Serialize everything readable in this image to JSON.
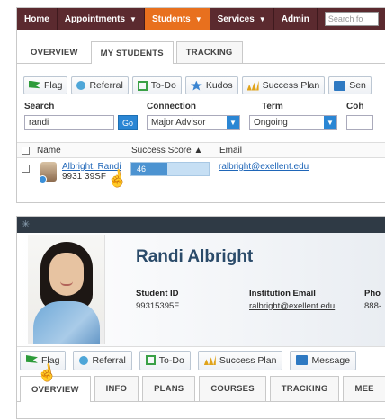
{
  "top": {
    "nav": {
      "items": [
        {
          "label": "Home",
          "caret": false
        },
        {
          "label": "Appointments",
          "caret": true
        },
        {
          "label": "Students",
          "caret": true,
          "active": true
        },
        {
          "label": "Services",
          "caret": true
        },
        {
          "label": "Admin",
          "caret": false
        }
      ],
      "search_placeholder": "Search fo",
      "caret_glyph": "▼"
    },
    "tabs": [
      {
        "label": "OVERVIEW"
      },
      {
        "label": "MY STUDENTS",
        "active": true
      },
      {
        "label": "TRACKING"
      }
    ],
    "actions": [
      {
        "label": "Flag",
        "icon": "flag-icon"
      },
      {
        "label": "Referral",
        "icon": "referral-icon"
      },
      {
        "label": "To-Do",
        "icon": "todo-icon"
      },
      {
        "label": "Kudos",
        "icon": "kudos-icon"
      },
      {
        "label": "Success Plan",
        "icon": "success-plan-icon"
      },
      {
        "label": "Sen",
        "icon": "message-icon"
      }
    ],
    "filters": {
      "search_label": "Search",
      "search_value": "randi",
      "go_label": "Go",
      "connection_label": "Connection",
      "connection_value": "Major Advisor",
      "term_label": "Term",
      "term_value": "Ongoing",
      "cohort_label": "Coh"
    },
    "table": {
      "headers": {
        "name": "Name",
        "score": "Success Score ▲",
        "email": "Email"
      },
      "row": {
        "name": "Albright, Randi",
        "id": "9931  39SF",
        "score": "46",
        "score_fraction": 0.46,
        "email": "ralbright@exellent.edu"
      }
    }
  },
  "bottom": {
    "name": "Randi Albright",
    "student_id_label": "Student ID",
    "student_id_value": "993153​95F",
    "inst_email_label": "Institution Email",
    "inst_email_value": "ralbright@exellent.edu",
    "phone_label": "Pho",
    "phone_value": "888-",
    "actions": [
      {
        "label": "Flag",
        "icon": "flag-icon"
      },
      {
        "label": "Referral",
        "icon": "referral-icon"
      },
      {
        "label": "To-Do",
        "icon": "todo-icon"
      },
      {
        "label": "Success Plan",
        "icon": "success-plan-icon"
      },
      {
        "label": "Message",
        "icon": "message-icon"
      }
    ],
    "tabs": [
      {
        "label": "OVERVIEW",
        "active": true
      },
      {
        "label": "INFO"
      },
      {
        "label": "PLANS"
      },
      {
        "label": "COURSES"
      },
      {
        "label": "TRACKING"
      },
      {
        "label": "MEE"
      }
    ]
  },
  "colors": {
    "nav_bg": "#5b2a2f",
    "nav_active": "#e8701e",
    "accent_blue": "#2a86d4",
    "name_color": "#2b4b6a"
  }
}
